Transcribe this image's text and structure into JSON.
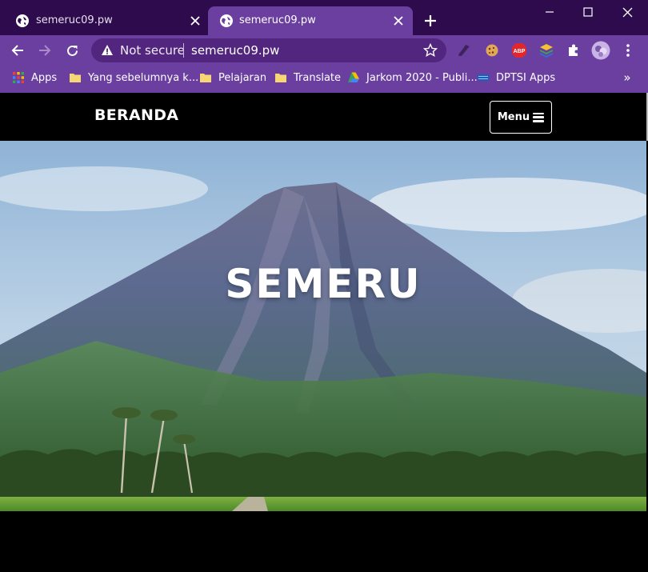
{
  "tabs": [
    {
      "title": "semeruc09.pw",
      "active": false,
      "icon": "globe-icon"
    },
    {
      "title": "semeruc09.pw",
      "active": true,
      "icon": "globe-icon"
    }
  ],
  "toolbar": {
    "security_label": "Not secure",
    "url": "semeruc09.pw"
  },
  "bookmarks": {
    "items": [
      {
        "label": "Apps",
        "icon": "apps-grid-icon"
      },
      {
        "label": "Yang sebelumnya k...",
        "icon": "folder-icon"
      },
      {
        "label": "Pelajaran",
        "icon": "folder-icon"
      },
      {
        "label": "Translate",
        "icon": "folder-icon"
      },
      {
        "label": "Jarkom 2020 - Publi...",
        "icon": "google-drive-icon"
      },
      {
        "label": "DPTSI Apps",
        "icon": "dptsi-icon"
      }
    ],
    "overflow": "»"
  },
  "site": {
    "brand": "BERANDA",
    "menu_label": "Menu",
    "hero_title": "SEMERU"
  },
  "colors": {
    "tab_strip": "#2d0b4d",
    "toolbar": "#6b3fa0",
    "omnibox": "#52267e",
    "page_bg": "#000000",
    "text_light": "#ffffff"
  }
}
